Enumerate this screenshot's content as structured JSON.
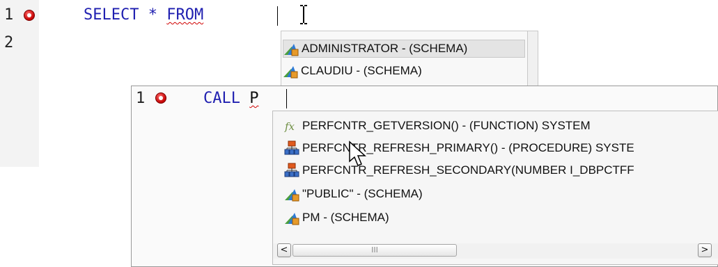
{
  "editor": {
    "lines": [
      {
        "number": "1",
        "code_keyword": "SELECT * FROM",
        "code_keyword_a": "SELECT * ",
        "code_squiggle": "FROM",
        "has_error": true
      },
      {
        "number": "2"
      }
    ]
  },
  "popup_outer": {
    "items": [
      {
        "label": "ADMINISTRATOR - (SCHEMA)",
        "icon": "schema-icon",
        "selected": true
      },
      {
        "label": "CLAUDIU - (SCHEMA)",
        "icon": "schema-icon",
        "selected": false
      }
    ]
  },
  "inner_editor": {
    "line_number": "1",
    "keyword": "CALL",
    "typed": "P"
  },
  "popup_inner": {
    "items": [
      {
        "label": "PERFCNTR_GETVERSION() - (FUNCTION) SYSTEM",
        "icon": "function-icon"
      },
      {
        "label": "PERFCNTR_REFRESH_PRIMARY() - (PROCEDURE) SYSTE",
        "icon": "procedure-icon"
      },
      {
        "label": "PERFCNTR_REFRESH_SECONDARY(NUMBER I_DBPCTFF",
        "icon": "procedure-icon"
      },
      {
        "label": "\"PUBLIC\" - (SCHEMA)",
        "icon": "schema-icon"
      },
      {
        "label": "PM - (SCHEMA)",
        "icon": "schema-icon"
      }
    ],
    "scrollbar": {
      "left": "<",
      "right": ">",
      "thumb": "III"
    }
  }
}
